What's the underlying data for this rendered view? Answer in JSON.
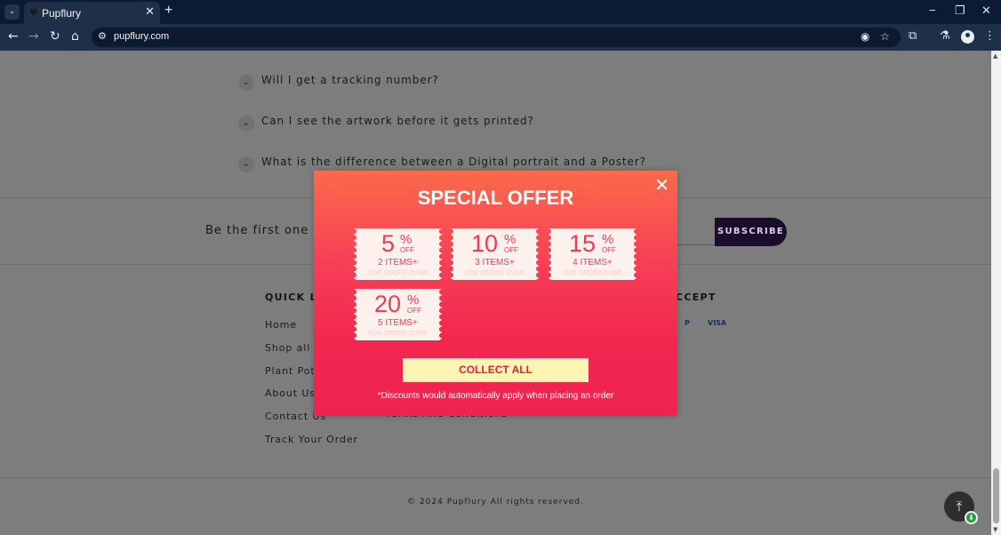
{
  "browser": {
    "tab_title": "Pupflury",
    "tab_menu_glyph": "⌄",
    "tab_close_glyph": "✕",
    "new_tab_glyph": "+",
    "url": "pupflury.com",
    "window": {
      "minimize": "−",
      "restore": "❐",
      "close": "✕"
    }
  },
  "faq": [
    {
      "question": "Will I get a tracking number?"
    },
    {
      "question": "Can I see the artwork before it gets printed?"
    },
    {
      "question": "What is the difference between a Digital portrait and a Poster?"
    }
  ],
  "newsletter": {
    "text": "Be the first one to k",
    "button": "SUBSCRIBE"
  },
  "footer": {
    "quick_links_heading": "QUICK LIN",
    "accept_heading": "CCEPT",
    "links": [
      "Home",
      "Shop all",
      "Plant Pot",
      "About Us",
      "Contact Us",
      "Track Your Order"
    ],
    "terms": "Terms And Conditions",
    "payment": [
      "P",
      "VISA"
    ],
    "copyright": "© 2024 Pupflury All rights reserved."
  },
  "popup": {
    "title": "SPECIAL OFFER",
    "close_glyph": "✕",
    "coupons": [
      {
        "percent": "5",
        "symbol": "%",
        "off": "OFF",
        "items": "2 ITEMS+",
        "sub": "FOR ORDER OVER"
      },
      {
        "percent": "10",
        "symbol": "%",
        "off": "OFF",
        "items": "3 ITEMS+",
        "sub": "FOR ORDER OVER"
      },
      {
        "percent": "15",
        "symbol": "%",
        "off": "OFF",
        "items": "4 ITEMS+",
        "sub": "FOR ORDER OVER"
      },
      {
        "percent": "20",
        "symbol": "%",
        "off": "OFF",
        "items": "5 ITEMS+",
        "sub": "FOR ORDER OVER"
      }
    ],
    "button": "COLLECT ALL",
    "note": "*Discounts would automatically apply when placing an order"
  },
  "colors": {
    "popup_top": "#fb6a4a",
    "popup_bottom": "#ee2351",
    "coupon_text": "#ee3a58",
    "collect_button_bg": "#fcf4b2",
    "subscribe_bg": "#1a0d2a"
  }
}
